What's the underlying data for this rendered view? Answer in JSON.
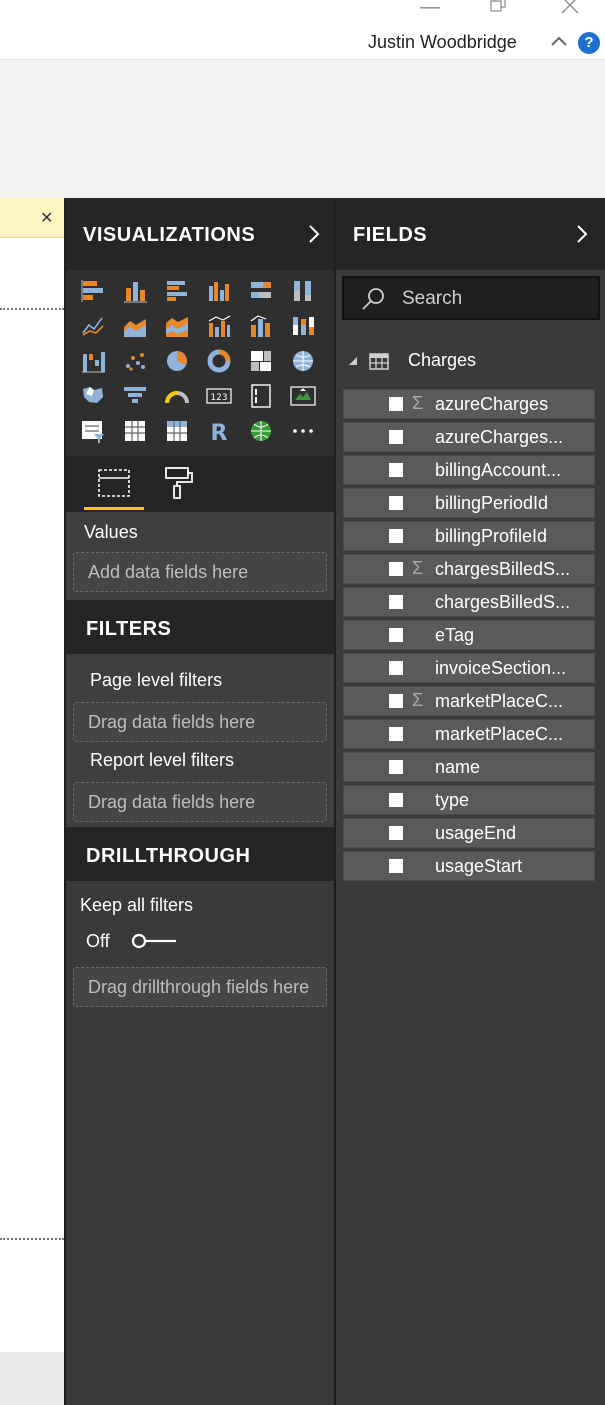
{
  "window": {
    "user_name": "Justin Woodbridge",
    "help_label": "?"
  },
  "visualizations": {
    "title": "VISUALIZATIONS",
    "icons": [
      "stacked-bar-chart-icon",
      "stacked-column-chart-icon",
      "clustered-bar-chart-icon",
      "clustered-column-chart-icon",
      "100-stacked-bar-chart-icon",
      "100-stacked-column-chart-icon",
      "line-chart-icon",
      "area-chart-icon",
      "stacked-area-chart-icon",
      "line-clustered-column-icon",
      "line-stacked-column-icon",
      "ribbon-chart-icon",
      "waterfall-chart-icon",
      "scatter-chart-icon",
      "pie-chart-icon",
      "donut-chart-icon",
      "treemap-icon",
      "map-icon",
      "filled-map-icon",
      "funnel-icon",
      "gauge-icon",
      "card-icon",
      "multi-row-card-icon",
      "kpi-icon",
      "slicer-icon",
      "table-icon",
      "matrix-icon",
      "r-script-visual-icon",
      "arcgis-map-icon",
      "more-visuals-icon"
    ],
    "values_label": "Values",
    "values_placeholder": "Add data fields here"
  },
  "filters": {
    "title": "FILTERS",
    "page_level_label": "Page level filters",
    "page_level_placeholder": "Drag data fields here",
    "report_level_label": "Report level filters",
    "report_level_placeholder": "Drag data fields here"
  },
  "drillthrough": {
    "title": "DRILLTHROUGH",
    "keep_all_label": "Keep all filters",
    "toggle_state": "Off",
    "placeholder": "Drag drillthrough fields here"
  },
  "fields": {
    "title": "FIELDS",
    "search_placeholder": "Search",
    "table_name": "Charges",
    "items": [
      {
        "label": "azureCharges",
        "sigma": true
      },
      {
        "label": "azureCharges...",
        "sigma": false
      },
      {
        "label": "billingAccount...",
        "sigma": false
      },
      {
        "label": "billingPeriodId",
        "sigma": false
      },
      {
        "label": "billingProfileId",
        "sigma": false
      },
      {
        "label": "chargesBilledS...",
        "sigma": true
      },
      {
        "label": "chargesBilledS...",
        "sigma": false
      },
      {
        "label": "eTag",
        "sigma": false
      },
      {
        "label": "invoiceSection...",
        "sigma": false
      },
      {
        "label": "marketPlaceC...",
        "sigma": true
      },
      {
        "label": "marketPlaceC...",
        "sigma": false
      },
      {
        "label": "name",
        "sigma": false
      },
      {
        "label": "type",
        "sigma": false
      },
      {
        "label": "usageEnd",
        "sigma": false
      },
      {
        "label": "usageStart",
        "sigma": false
      }
    ]
  },
  "colors": {
    "accent": "#f2c811",
    "pane_bg": "#3a3a3a",
    "header_bg": "#252525",
    "help_blue": "#1f6fd1"
  }
}
